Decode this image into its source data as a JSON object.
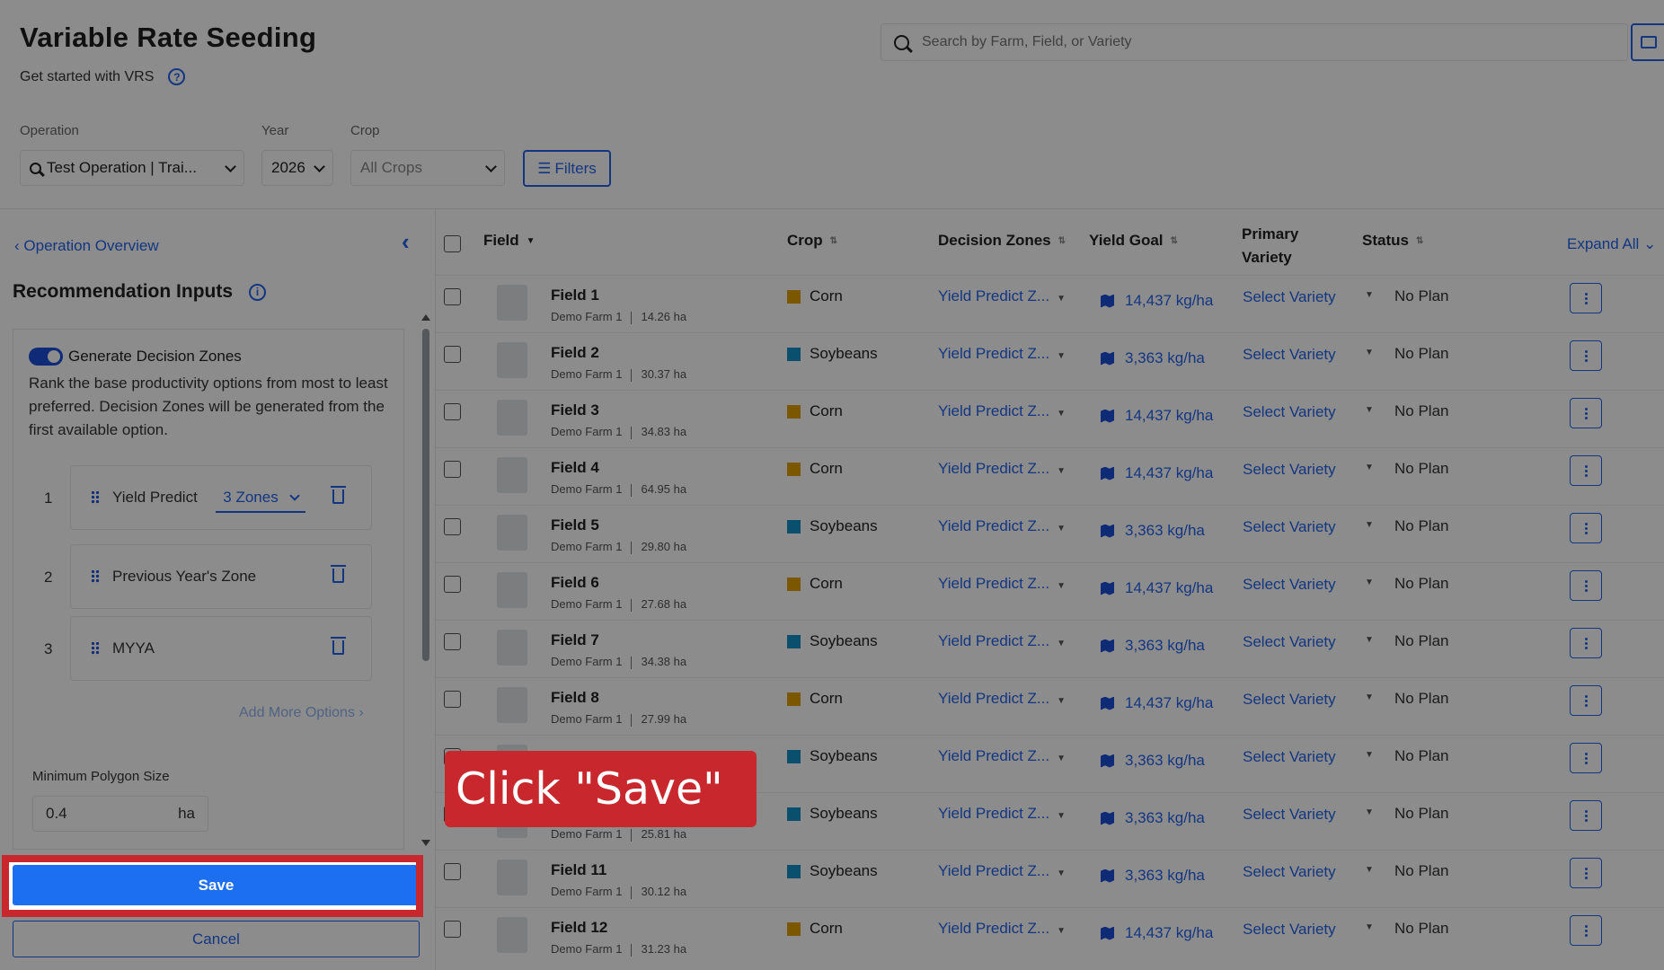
{
  "header": {
    "title": "Variable Rate Seeding",
    "subtitle": "Get started with VRS",
    "search_placeholder": "Search by Farm, Field, or Variety"
  },
  "filters": {
    "operation_label": "Operation",
    "operation_value": "Test Operation | Trai...",
    "year_label": "Year",
    "year_value": "2026",
    "crop_label": "Crop",
    "crop_value": "All Crops",
    "filters_button": "Filters"
  },
  "left_panel": {
    "back_link": "Operation Overview",
    "section_title": "Recommendation Inputs",
    "toggle_label": "Generate Decision Zones",
    "description": "Rank the base productivity options from most to least preferred. Decision Zones will be generated from the first available option.",
    "options": [
      {
        "num": "1",
        "label": "Yield Predict",
        "zones": "3 Zones"
      },
      {
        "num": "2",
        "label": "Previous Year's Zone"
      },
      {
        "num": "3",
        "label": "MYYA"
      }
    ],
    "add_more": "Add More Options",
    "min_polygon_label": "Minimum Polygon Size",
    "min_polygon_value": "0.4",
    "min_polygon_unit": "ha",
    "save_label": "Save",
    "cancel_label": "Cancel"
  },
  "table": {
    "headers": {
      "field": "Field",
      "crop": "Crop",
      "decision_zones": "Decision Zones",
      "yield_goal": "Yield Goal",
      "primary_variety_1": "Primary",
      "primary_variety_2": "Variety",
      "status": "Status",
      "expand_all": "Expand All"
    },
    "rows": [
      {
        "name": "Field 1",
        "farm": "Demo Farm 1",
        "area": "14.26 ha",
        "crop": "Corn",
        "dz": "Yield Predict Z...",
        "yield": "14,437 kg/ha",
        "variety": "Select Variety",
        "status": "No Plan"
      },
      {
        "name": "Field 2",
        "farm": "Demo Farm 1",
        "area": "30.37 ha",
        "crop": "Soybeans",
        "dz": "Yield Predict Z...",
        "yield": "3,363 kg/ha",
        "variety": "Select Variety",
        "status": "No Plan"
      },
      {
        "name": "Field 3",
        "farm": "Demo Farm 1",
        "area": "34.83 ha",
        "crop": "Corn",
        "dz": "Yield Predict Z...",
        "yield": "14,437 kg/ha",
        "variety": "Select Variety",
        "status": "No Plan"
      },
      {
        "name": "Field 4",
        "farm": "Demo Farm 1",
        "area": "64.95 ha",
        "crop": "Corn",
        "dz": "Yield Predict Z...",
        "yield": "14,437 kg/ha",
        "variety": "Select Variety",
        "status": "No Plan"
      },
      {
        "name": "Field 5",
        "farm": "Demo Farm 1",
        "area": "29.80 ha",
        "crop": "Soybeans",
        "dz": "Yield Predict Z...",
        "yield": "3,363 kg/ha",
        "variety": "Select Variety",
        "status": "No Plan"
      },
      {
        "name": "Field 6",
        "farm": "Demo Farm 1",
        "area": "27.68 ha",
        "crop": "Corn",
        "dz": "Yield Predict Z...",
        "yield": "14,437 kg/ha",
        "variety": "Select Variety",
        "status": "No Plan"
      },
      {
        "name": "Field 7",
        "farm": "Demo Farm 1",
        "area": "34.38 ha",
        "crop": "Soybeans",
        "dz": "Yield Predict Z...",
        "yield": "3,363 kg/ha",
        "variety": "Select Variety",
        "status": "No Plan"
      },
      {
        "name": "Field 8",
        "farm": "Demo Farm 1",
        "area": "27.99 ha",
        "crop": "Corn",
        "dz": "Yield Predict Z...",
        "yield": "14,437 kg/ha",
        "variety": "Select Variety",
        "status": "No Plan"
      },
      {
        "name": "",
        "farm": "",
        "area": "",
        "crop": "Soybeans",
        "dz": "Yield Predict Z...",
        "yield": "3,363 kg/ha",
        "variety": "Select Variety",
        "status": "No Plan"
      },
      {
        "name": "",
        "farm": "Demo Farm 1",
        "area": "25.81 ha",
        "crop": "Soybeans",
        "dz": "Yield Predict Z...",
        "yield": "3,363 kg/ha",
        "variety": "Select Variety",
        "status": "No Plan"
      },
      {
        "name": "Field 11",
        "farm": "Demo Farm 1",
        "area": "30.12 ha",
        "crop": "Soybeans",
        "dz": "Yield Predict Z...",
        "yield": "3,363 kg/ha",
        "variety": "Select Variety",
        "status": "No Plan"
      },
      {
        "name": "Field 12",
        "farm": "Demo Farm 1",
        "area": "31.23 ha",
        "crop": "Corn",
        "dz": "Yield Predict Z...",
        "yield": "14,437 kg/ha",
        "variety": "Select Variety",
        "status": "No Plan"
      }
    ]
  },
  "colors": {
    "corn": "#e0a100",
    "soybeans": "#1590c8",
    "accent": "#2563eb",
    "callout": "#c8282d"
  },
  "callout": {
    "text": "Click \"Save\""
  }
}
